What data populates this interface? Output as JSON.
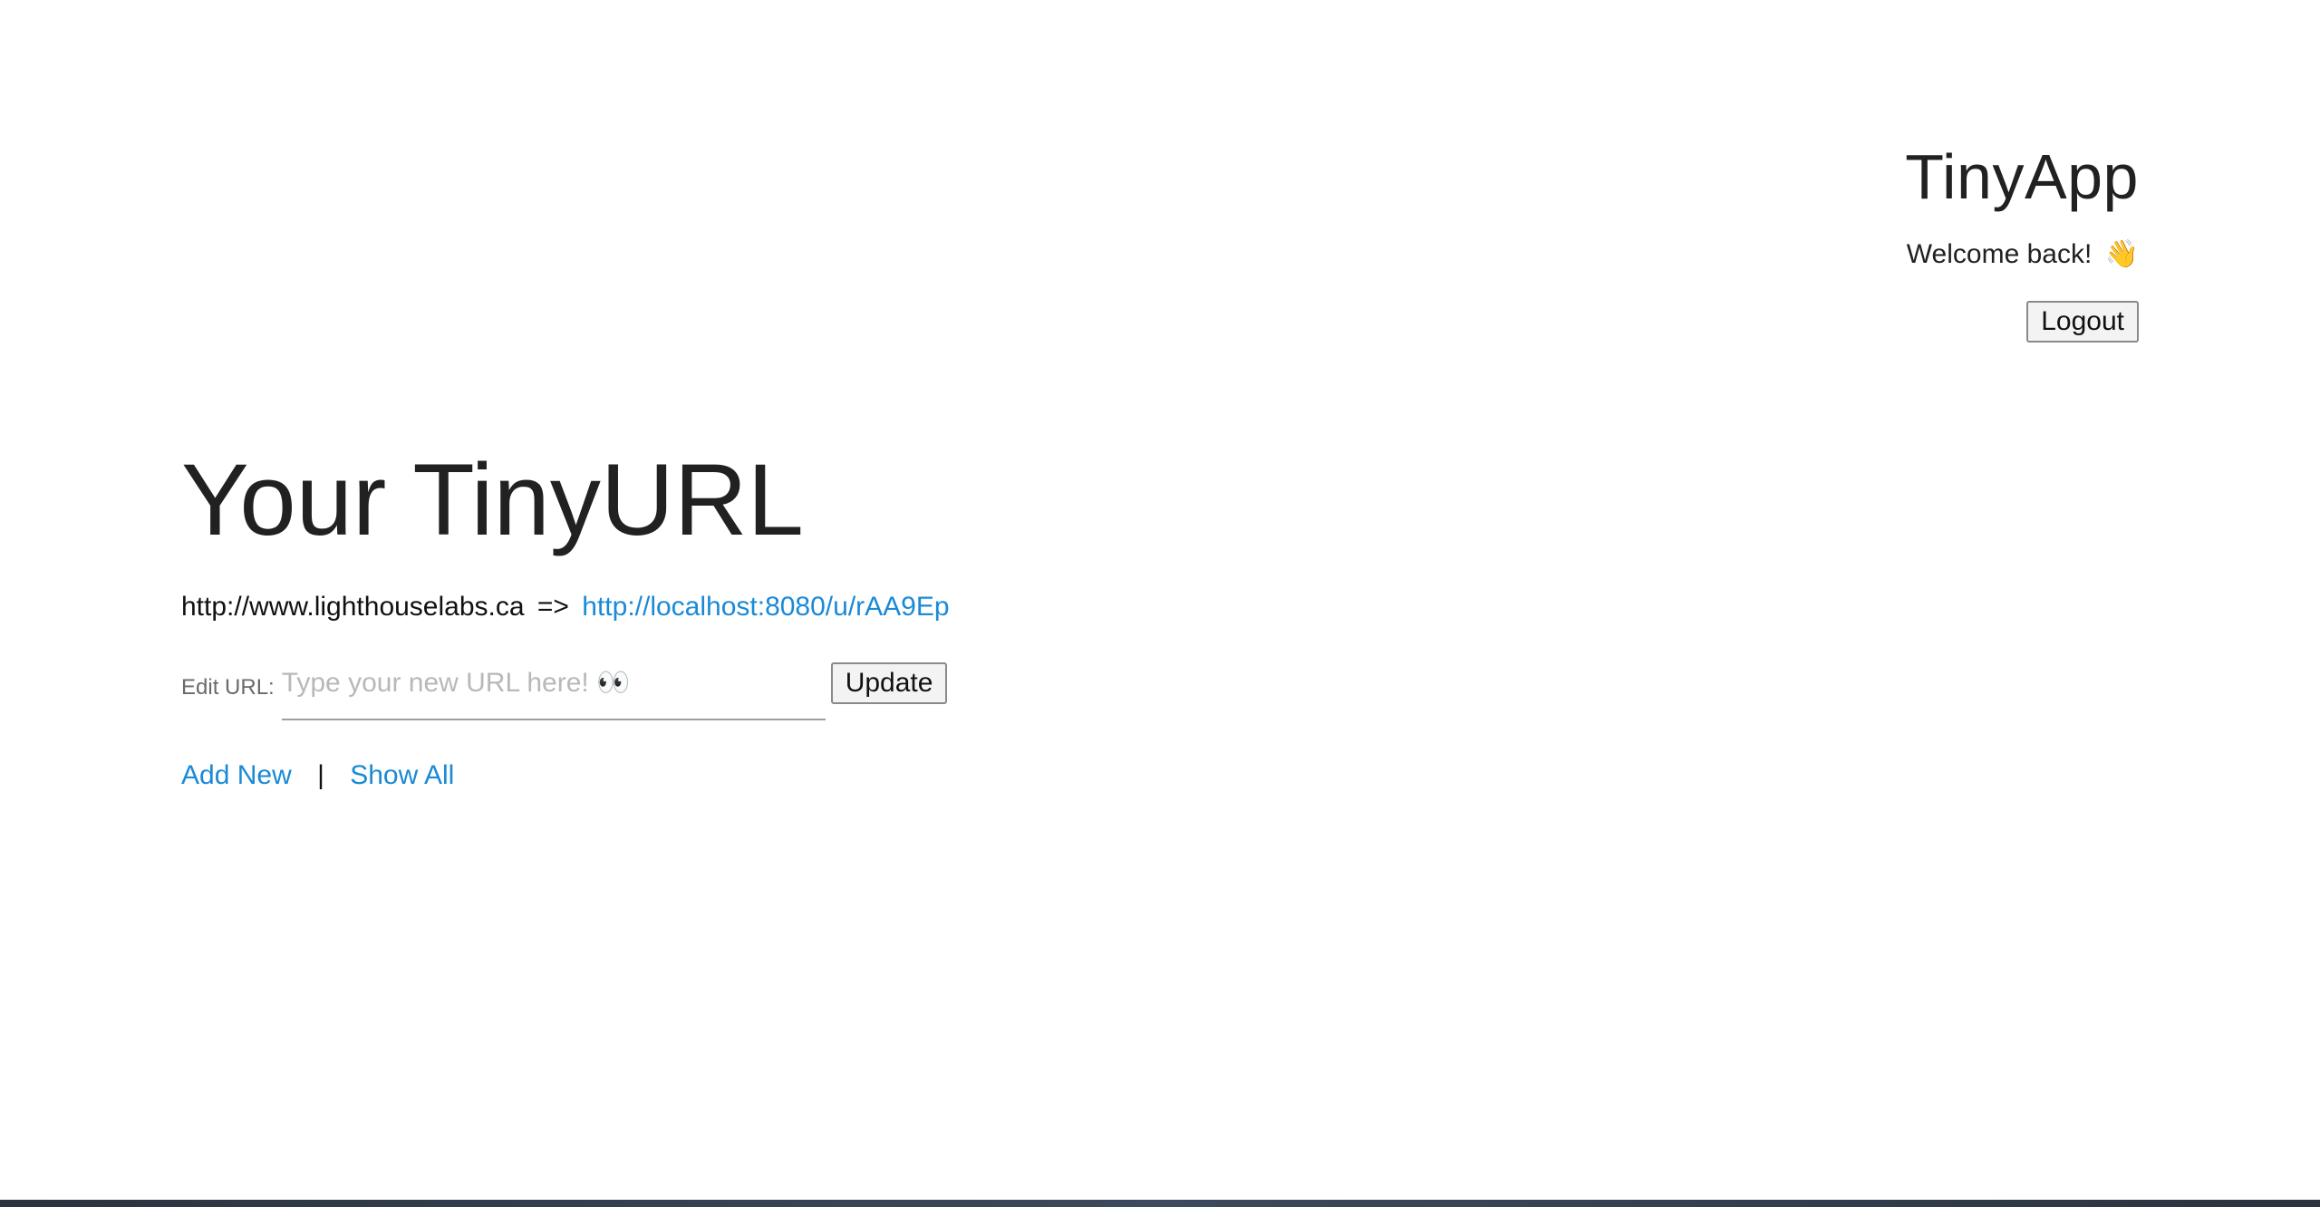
{
  "header": {
    "title": "TinyApp",
    "welcome": "Welcome back!",
    "wave_emoji": "👋",
    "logout_label": "Logout"
  },
  "main": {
    "title": "Your TinyURL",
    "long_url": "http://www.lighthouselabs.ca",
    "arrow": "=>",
    "short_url": "http://localhost:8080/u/rAA9Ep",
    "edit_label": "Edit URL:",
    "edit_placeholder": "Type your new URL here! 👀",
    "update_label": "Update"
  },
  "nav": {
    "add_new": "Add New",
    "separator": "|",
    "show_all": "Show All"
  },
  "colors": {
    "link": "#1a8ad6",
    "text": "#212121"
  }
}
